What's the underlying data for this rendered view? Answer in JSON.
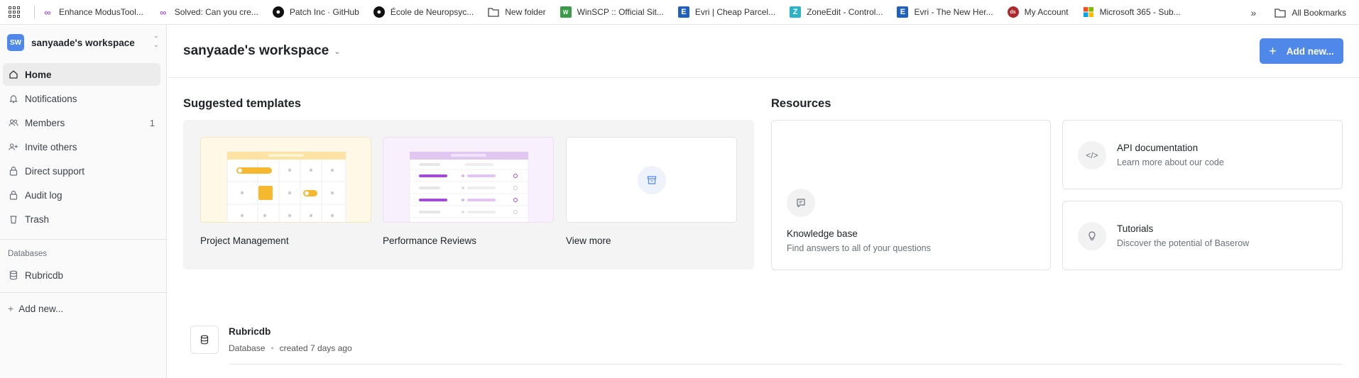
{
  "bookmarks": {
    "items": [
      {
        "label": "Enhance ModusTool...",
        "icon": "modus-icon",
        "color": "#a45dd6"
      },
      {
        "label": "Solved: Can you cre...",
        "icon": "modus-icon",
        "color": "#a45dd6"
      },
      {
        "label": "Patch Inc · GitHub",
        "icon": "github-icon",
        "color": "#111111"
      },
      {
        "label": "École de Neuropsyc...",
        "icon": "github-icon",
        "color": "#111111"
      },
      {
        "label": "New folder",
        "icon": "folder-icon",
        "color": "#444444"
      },
      {
        "label": "WinSCP :: Official Sit...",
        "icon": "winscp-icon",
        "color": "#3a9b46"
      },
      {
        "label": "Evri | Cheap Parcel...",
        "icon": "evri-icon",
        "color": "#1f5fbf"
      },
      {
        "label": "ZoneEdit - Control...",
        "icon": "zoneedit-icon",
        "color": "#2bb3c9"
      },
      {
        "label": "Evri - The New Her...",
        "icon": "evri-icon",
        "color": "#1f5fbf"
      },
      {
        "label": "My Account",
        "icon": "account-icon",
        "color": "#b0282a"
      },
      {
        "label": "Microsoft 365 - Sub...",
        "icon": "microsoft-icon",
        "color": "#f25022"
      }
    ],
    "all_bookmarks": "All Bookmarks"
  },
  "sidebar": {
    "workspace_initials": "SW",
    "workspace_name": "sanyaade's workspace",
    "items": [
      {
        "label": "Home",
        "icon": "home-icon",
        "active": true
      },
      {
        "label": "Notifications",
        "icon": "bell-icon"
      },
      {
        "label": "Members",
        "icon": "users-icon",
        "count": "1"
      },
      {
        "label": "Invite others",
        "icon": "user-plus-icon"
      },
      {
        "label": "Direct support",
        "icon": "lock-icon"
      },
      {
        "label": "Audit log",
        "icon": "lock-icon"
      },
      {
        "label": "Trash",
        "icon": "trash-icon"
      }
    ],
    "databases_heading": "Databases",
    "databases": [
      {
        "label": "Rubricdb",
        "icon": "database-icon"
      }
    ],
    "add_new": "Add new..."
  },
  "header": {
    "title": "sanyaade's workspace",
    "add_button": "Add new..."
  },
  "templates": {
    "heading": "Suggested templates",
    "items": [
      {
        "label": "Project Management"
      },
      {
        "label": "Performance Reviews"
      },
      {
        "label": "View more"
      }
    ]
  },
  "resources": {
    "heading": "Resources",
    "knowledge": {
      "title": "Knowledge base",
      "desc": "Find answers to all of your questions"
    },
    "api": {
      "title": "API documentation",
      "desc": "Learn more about our code"
    },
    "tutorials": {
      "title": "Tutorials",
      "desc": "Discover the potential of Baserow"
    }
  },
  "databases_list": [
    {
      "name": "Rubricdb",
      "type": "Database",
      "created": "created 7 days ago"
    }
  ],
  "colors": {
    "accent": "#4f88e8"
  }
}
